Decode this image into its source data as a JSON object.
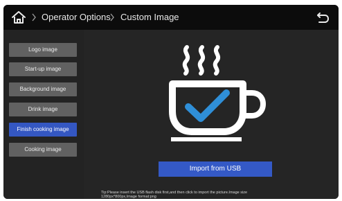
{
  "topbar": {
    "breadcrumb": [
      "Operator Options",
      "Custom Image"
    ]
  },
  "icons": {
    "home": "home-icon",
    "separator": "chevron-right-icon",
    "back": "return-icon",
    "illustration": "coffee-cup-check-icon"
  },
  "sidebar": {
    "items": [
      {
        "label": "Logo image",
        "active": false
      },
      {
        "label": "Start-up image",
        "active": false
      },
      {
        "label": "Background image",
        "active": false
      },
      {
        "label": "Drink image",
        "active": false
      },
      {
        "label": "Finish cooking image",
        "active": true
      },
      {
        "label": "Cooking image",
        "active": false
      }
    ]
  },
  "main": {
    "import_label": "Import from USB",
    "tip_lines": [
      "Tip:Please insert the USB flash disk first,and then click to import the picture.Image size",
      "1280px*800px,Image format:png"
    ]
  },
  "colors": {
    "screen": "#232323",
    "topbar": "#0c0c0c",
    "menu_item": "#616161",
    "menu_active": "#3457c2",
    "button": "#3459c6",
    "illustration_white": "#ffffff",
    "check_blue": "#2f8fd8"
  }
}
